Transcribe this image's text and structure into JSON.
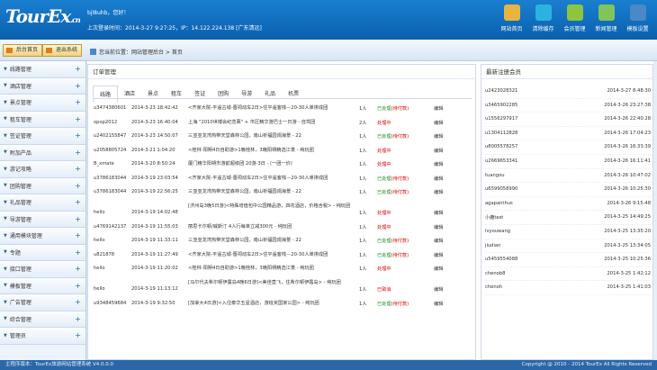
{
  "header": {
    "logo_main": "TourEx",
    "logo_suffix": ".cn",
    "welcome": "bjl8uhb，您好！",
    "last_login": "上次登录时间：2014-3-27 9:27:25，IP：14.122.224.138 [广东清远]",
    "nav": [
      {
        "label": "网站首页",
        "icon": "home-icon",
        "color": "#e8b343"
      },
      {
        "label": "清除缓存",
        "icon": "refresh-icon",
        "color": "#2bb3e0"
      },
      {
        "label": "会员管理",
        "icon": "members-icon",
        "color": "#8cc63f"
      },
      {
        "label": "新闻管理",
        "icon": "news-icon",
        "color": "#7fc65a"
      },
      {
        "label": "模板设置",
        "icon": "template-icon",
        "color": "#4a88c8"
      }
    ]
  },
  "toolbar": {
    "home_btn": "后台首页",
    "logout_btn": "退出系统",
    "breadcrumb": "您当前位置：网站管理后台 > 首页"
  },
  "sidebar": {
    "items": [
      {
        "label": "线路管理"
      },
      {
        "label": "酒店管理"
      },
      {
        "label": "景点管理"
      },
      {
        "label": "租车管理"
      },
      {
        "label": "签证管理"
      },
      {
        "label": "附加产品"
      },
      {
        "label": "游记攻略"
      },
      {
        "label": "团购管理"
      },
      {
        "label": "礼品管理"
      },
      {
        "label": "导游管理"
      },
      {
        "label": "通用模块管理"
      },
      {
        "label": "专题"
      },
      {
        "label": "接口管理"
      },
      {
        "label": "模板管理"
      },
      {
        "label": "广告管理"
      },
      {
        "label": "综合管理"
      },
      {
        "label": "管理员"
      }
    ]
  },
  "orders": {
    "title": "订单管理",
    "tabs": [
      "线路",
      "酒店",
      "景点",
      "租车",
      "签证",
      "团购",
      "导游",
      "礼品",
      "机票"
    ],
    "rows": [
      {
        "user": "u3474380601",
        "time": "2014-3-23 18:42:42",
        "product": "<齐家大院-平遥古城-晋祠动车2日>住平遥客栈－20-30人单排成团",
        "qty": "1人",
        "status": "已处理",
        "status_sub": "(待付款)",
        "edit": "编辑",
        "tall": false
      },
      {
        "user": "opop2012",
        "time": "2014-3-23 16:40:04",
        "product": "上海 \"2010世博会纪念票\" + 市区精华游巴士一日游 - 自驾团",
        "qty": "2人",
        "status": "处理中",
        "status_sub": "",
        "edit": "编辑",
        "tall": false
      },
      {
        "user": "u2402155847",
        "time": "2014-3-23 14:50:07",
        "product": "三亚亚龙湾热带天堂森林公园，南山祈福园观海景 - 22",
        "qty": "1人",
        "status": "已处理",
        "status_sub": "(待付款)",
        "edit": "编辑",
        "tall": false
      },
      {
        "user": "u2058805724",
        "time": "2014-3-21 1:04:20",
        "product": "<桂林-阳朔4日自助游>1晚桂林，3晚阳朔精选江景 - 纯玩团",
        "qty": "1人",
        "status": "处理中",
        "status_sub": "",
        "edit": "编辑",
        "tall": false
      },
      {
        "user": "B_xmate",
        "time": "2014-3-20 8:50:24",
        "product": "厦门精华阳朔市游前超级团 20游·3日 - (一团一价)",
        "qty": "1人",
        "status": "处理中",
        "status_sub": "",
        "edit": "编辑",
        "tall": false
      },
      {
        "user": "u3786183044",
        "time": "2014-3-19 23:03:54",
        "product": "<齐家大院-平遥古城-晋祠动车2日>住平遥客栈－20-30人单排成团",
        "qty": "1人",
        "status": "已处理",
        "status_sub": "(待付款)",
        "edit": "编辑",
        "tall": false
      },
      {
        "user": "u3786183044",
        "time": "2014-3-19 22:56:25",
        "product": "三亚亚龙湾热带天堂森林公园，南山祈福园观海景 - 22",
        "qty": "1人",
        "status": "已处理",
        "status_sub": "(待付款)",
        "edit": "编辑",
        "tall": false
      },
      {
        "user": "hello",
        "time": "2014-3-19 14:02:48",
        "product": "[济州岛3晚5日游]<特殊增值包中公园精品游，四花酒店，价格含税> - 纯玩团",
        "qty": "1人",
        "status": "处理中",
        "status_sub": "",
        "edit": "编辑",
        "tall": true
      },
      {
        "user": "u4769142137",
        "time": "2014-3-19 11:55:03",
        "product": "丽思卡尔顿/威斯汀 4人行每单立减300元 - 纯玩团",
        "qty": "1人",
        "status": "处理中",
        "status_sub": "",
        "edit": "编辑",
        "tall": false
      },
      {
        "user": "hello",
        "time": "2014-3-19 11:33:11",
        "product": "三亚亚龙湾热带天堂森林公园，南山祈福园观海景 - 22",
        "qty": "1人",
        "status": "已处理",
        "status_sub": "(待付款)",
        "edit": "编辑",
        "tall": false
      },
      {
        "user": "u821878",
        "time": "2014-3-19 11:27:49",
        "product": "<齐家大院-平遥古城-晋祠动车2日>住平遥客栈－20-30人单排成团",
        "qty": "1人",
        "status": "已处理",
        "status_sub": "(待付款)",
        "edit": "编辑",
        "tall": false
      },
      {
        "user": "hello",
        "time": "2014-3-19 11:20:02",
        "product": "<桂林-阳朔4日自助游>1晚桂林，3晚阳朔精选江景 - 纯玩团",
        "qty": "1人",
        "status": "处理中",
        "status_sub": "",
        "edit": "编辑",
        "tall": false
      },
      {
        "user": "hello",
        "time": "2014-3-19 11:13:12",
        "product": "[马尔代夫希尔顿伊露岛4晚6日游]<美佳直飞，住希尔顿伊露岛> - 纯玩团",
        "qty": "1人",
        "status": "已取消",
        "status_sub": "",
        "edit": "编辑",
        "tall": true
      },
      {
        "user": "u9348459684",
        "time": "2014-3-19 9:32:50",
        "product": "[加拿大4日游]<入住泰华五星酒店，游班芙国家公园> - 纯玩团",
        "qty": "1人",
        "status": "已处理",
        "status_sub": "(待付款)",
        "edit": "编辑",
        "tall": false
      }
    ]
  },
  "registrations": {
    "title": "最新注册会员",
    "rows": [
      {
        "name": "u2423028321",
        "time": "2014-3-27 8:48:30"
      },
      {
        "name": "u3465902285",
        "time": "2014-3-26 23:27:38"
      },
      {
        "name": "u1556297917",
        "time": "2014-3-26 22:40:28"
      },
      {
        "name": "u1304112828",
        "time": "2014-3-26 17:04:23"
      },
      {
        "name": "u8005578257",
        "time": "2014-3-26 16:33:39"
      },
      {
        "name": "u2669653341",
        "time": "2014-3-26 16:11:41"
      },
      {
        "name": "tuangou",
        "time": "2014-3-26 10:47:02"
      },
      {
        "name": "u6599058990",
        "time": "2014-3-26 10:25:30"
      },
      {
        "name": "agapanthus",
        "time": "2014-3-26 9:15:48"
      },
      {
        "name": "小鹿test",
        "time": "2014-3-25 14:49:25"
      },
      {
        "name": "lvyouwang",
        "time": "2014-3-25 13:35:20"
      },
      {
        "name": "jiudian",
        "time": "2014-3-25 13:34:05"
      },
      {
        "name": "u5459554088",
        "time": "2014-3-25 10:25:36"
      },
      {
        "name": "chenob8",
        "time": "2014-3-25 1:42:12"
      },
      {
        "name": "chenoh",
        "time": "2014-3-25 1:41:03"
      }
    ]
  },
  "footer": {
    "left": "主程序版本：TourEx旅游网站管理系统 V4.0.0.0",
    "right": "Copyright @ 2010 - 2014 TourEx All Rights Reserved"
  }
}
